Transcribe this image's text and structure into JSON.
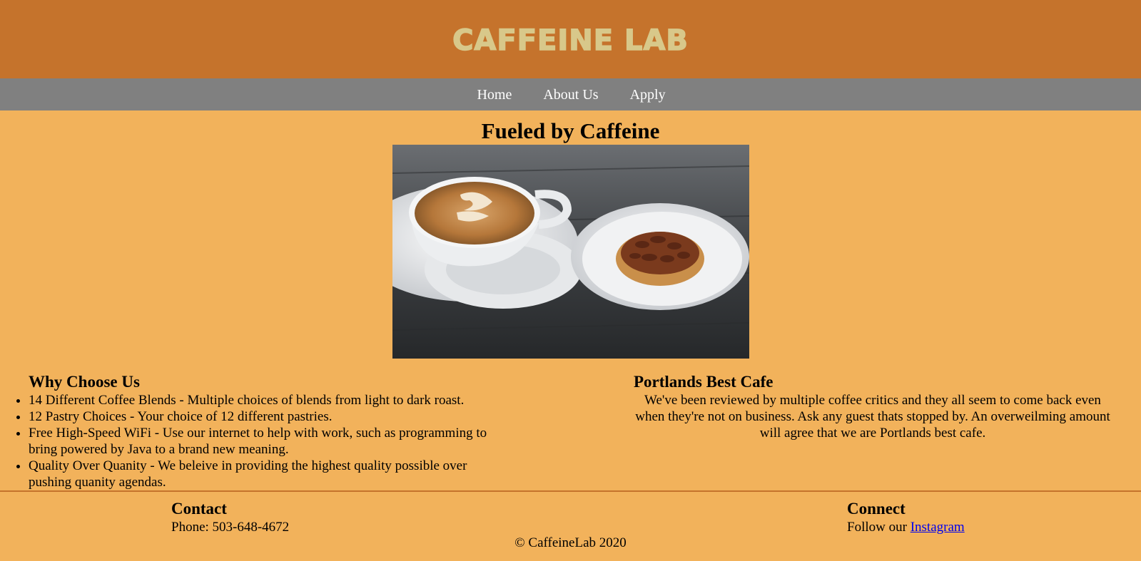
{
  "header": {
    "logo_text": "CAFFEINE LAB",
    "brand_color": "#c5732c",
    "logo_color": "#d8c88a"
  },
  "nav": {
    "items": [
      {
        "label": "Home"
      },
      {
        "label": "About Us"
      },
      {
        "label": "Apply"
      }
    ],
    "bg_color": "#808080"
  },
  "hero": {
    "title": "Fueled by Caffeine",
    "image_icon": "latte-and-pecan-tart-photo"
  },
  "why": {
    "title": "Why Choose Us",
    "items": [
      "14 Different Coffee Blends - Multiple choices of blends from light to dark roast.",
      "12 Pastry Choices - Your choice of 12 different pastries.",
      "Free High-Speed WiFi - Use our internet to help with work, such as programming to bring powered by Java to a brand new meaning.",
      "Quality Over Quanity - We beleive in providing the highest quality possible over pushing quanity agendas."
    ]
  },
  "best": {
    "title": "Portlands Best Cafe",
    "text": "We've been reviewed by multiple coffee critics and they all seem to come back even when they're not on business. Ask any guest thats stopped by. An overweilming amount will agree that we are Portlands best cafe."
  },
  "footer": {
    "contact_title": "Contact",
    "phone": "Phone: 503-648-4672",
    "connect_title": "Connect",
    "follow_text": "Follow our ",
    "instagram_label": "Instagram",
    "copyright": "© CaffeineLab 2020"
  },
  "page_bg": "#f2b25b"
}
